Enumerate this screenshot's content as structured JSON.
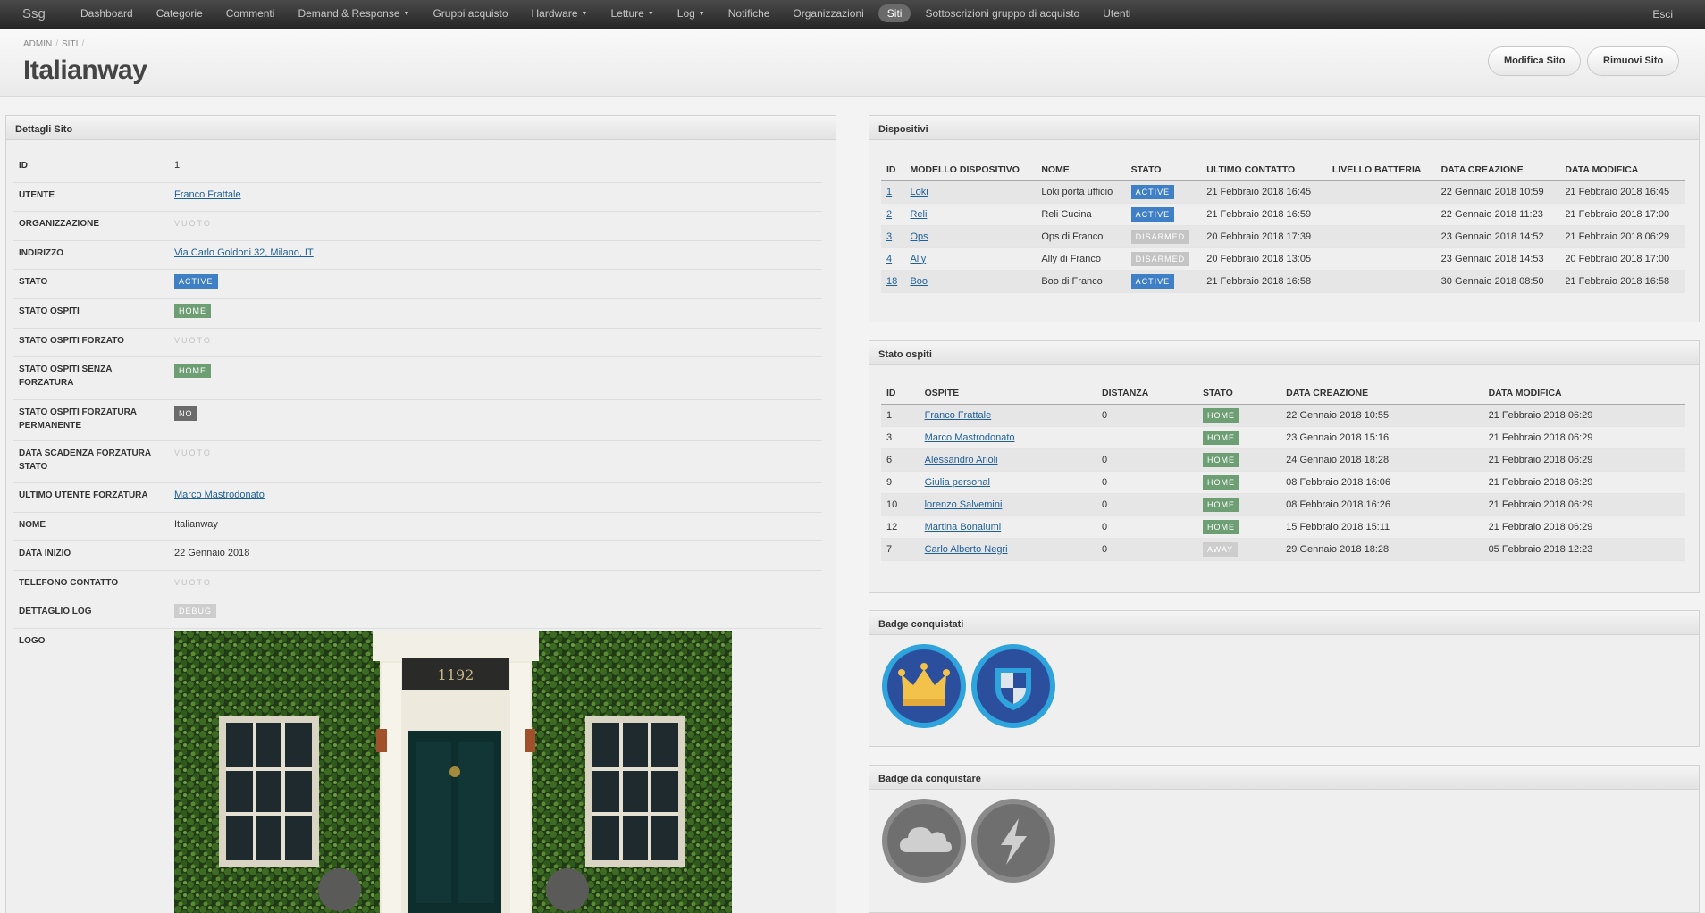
{
  "nav": {
    "brand": "Ssg",
    "items": [
      {
        "label": "Dashboard",
        "caret": false,
        "active": false
      },
      {
        "label": "Categorie",
        "caret": false,
        "active": false
      },
      {
        "label": "Commenti",
        "caret": false,
        "active": false
      },
      {
        "label": "Demand & Response",
        "caret": true,
        "active": false
      },
      {
        "label": "Gruppi acquisto",
        "caret": false,
        "active": false
      },
      {
        "label": "Hardware",
        "caret": true,
        "active": false
      },
      {
        "label": "Letture",
        "caret": true,
        "active": false
      },
      {
        "label": "Log",
        "caret": true,
        "active": false
      },
      {
        "label": "Notifiche",
        "caret": false,
        "active": false
      },
      {
        "label": "Organizzazioni",
        "caret": false,
        "active": false
      },
      {
        "label": "Siti",
        "caret": false,
        "active": true
      },
      {
        "label": "Sottoscrizioni gruppo di acquisto",
        "caret": false,
        "active": false
      },
      {
        "label": "Utenti",
        "caret": false,
        "active": false
      }
    ],
    "logout": "Esci"
  },
  "header": {
    "breadcrumb": [
      "ADMIN",
      "SITI"
    ],
    "breadcrumb_sep": "/",
    "title": "Italianway",
    "edit_button": "Modifica Sito",
    "remove_button": "Rimuovi Sito"
  },
  "details": {
    "title": "Dettagli Sito",
    "rows": [
      {
        "label": "ID",
        "value": "1",
        "type": "text"
      },
      {
        "label": "UTENTE",
        "value": "Franco Frattale",
        "type": "link"
      },
      {
        "label": "ORGANIZZAZIONE",
        "value": "VUOTO",
        "type": "empty"
      },
      {
        "label": "INDIRIZZO",
        "value": "Via Carlo Goldoni 32, Milano, IT",
        "type": "link"
      },
      {
        "label": "STATO",
        "value": "ACTIVE",
        "type": "badge",
        "color": "#3f7fc5"
      },
      {
        "label": "STATO OSPITI",
        "value": "HOME",
        "type": "badge",
        "color": "#6e9e74"
      },
      {
        "label": "STATO OSPITI FORZATO",
        "value": "VUOTO",
        "type": "empty"
      },
      {
        "label": "STATO OSPITI SENZA FORZATURA",
        "value": "HOME",
        "type": "badge",
        "color": "#6e9e74"
      },
      {
        "label": "STATO OSPITI FORZATURA PERMANENTE",
        "value": "NO",
        "type": "badge",
        "color": "#6b6b6b"
      },
      {
        "label": "DATA SCADENZA FORZATURA STATO",
        "value": "VUOTO",
        "type": "empty"
      },
      {
        "label": "ULTIMO UTENTE FORZATURA",
        "value": "Marco Mastrodonato",
        "type": "link"
      },
      {
        "label": "NOME",
        "value": "Italianway",
        "type": "text"
      },
      {
        "label": "DATA INIZIO",
        "value": "22 Gennaio 2018",
        "type": "text"
      },
      {
        "label": "TELEFONO CONTATTO",
        "value": "VUOTO",
        "type": "empty"
      },
      {
        "label": "DETTAGLIO LOG",
        "value": "DEBUG",
        "type": "badge",
        "color": "#cdcdcd"
      },
      {
        "label": "LOGO",
        "value": "",
        "type": "image"
      }
    ],
    "logo_number": "1192"
  },
  "devices": {
    "title": "Dispositivi",
    "columns": [
      "ID",
      "MODELLO DISPOSITIVO",
      "NOME",
      "STATO",
      "ULTIMO CONTATTO",
      "LIVELLO BATTERIA",
      "DATA CREAZIONE",
      "DATA MODIFICA"
    ],
    "rows": [
      {
        "id": "1",
        "model": "Loki",
        "name": "Loki porta ufficio",
        "status": "ACTIVE",
        "status_color": "#3f7fc5",
        "last_contact": "21 Febbraio 2018 16:45",
        "battery": "",
        "created": "22 Gennaio 2018 10:59",
        "modified": "21 Febbraio 2018 16:45"
      },
      {
        "id": "2",
        "model": "Reli",
        "name": "Reli Cucina",
        "status": "ACTIVE",
        "status_color": "#3f7fc5",
        "last_contact": "21 Febbraio 2018 16:59",
        "battery": "",
        "created": "22 Gennaio 2018 11:23",
        "modified": "21 Febbraio 2018 17:00"
      },
      {
        "id": "3",
        "model": "Ops",
        "name": "Ops di Franco",
        "status": "DISARMED",
        "status_color": "#c4c4c4",
        "last_contact": "20 Febbraio 2018 17:39",
        "battery": "",
        "created": "23 Gennaio 2018 14:52",
        "modified": "21 Febbraio 2018 06:29"
      },
      {
        "id": "4",
        "model": "Ally",
        "name": "Ally di Franco",
        "status": "DISARMED",
        "status_color": "#c4c4c4",
        "last_contact": "20 Febbraio 2018 13:05",
        "battery": "",
        "created": "23 Gennaio 2018 14:53",
        "modified": "20 Febbraio 2018 17:00"
      },
      {
        "id": "18",
        "model": "Boo",
        "name": "Boo di Franco",
        "status": "ACTIVE",
        "status_color": "#3f7fc5",
        "last_contact": "21 Febbraio 2018 16:58",
        "battery": "",
        "created": "30 Gennaio 2018 08:50",
        "modified": "21 Febbraio 2018 16:58"
      }
    ]
  },
  "guests": {
    "title": "Stato ospiti",
    "columns": [
      "ID",
      "OSPITE",
      "DISTANZA",
      "STATO",
      "DATA CREAZIONE",
      "DATA MODIFICA"
    ],
    "rows": [
      {
        "id": "1",
        "guest": "Franco Frattale",
        "distance": "0",
        "status": "HOME",
        "status_color": "#6e9e74",
        "created": "22 Gennaio 2018 10:55",
        "modified": "21 Febbraio 2018 06:29"
      },
      {
        "id": "3",
        "guest": "Marco Mastrodonato",
        "distance": "",
        "status": "HOME",
        "status_color": "#6e9e74",
        "created": "23 Gennaio 2018 15:16",
        "modified": "21 Febbraio 2018 06:29"
      },
      {
        "id": "6",
        "guest": "Alessandro Arioli",
        "distance": "0",
        "status": "HOME",
        "status_color": "#6e9e74",
        "created": "24 Gennaio 2018 18:28",
        "modified": "21 Febbraio 2018 06:29"
      },
      {
        "id": "9",
        "guest": "Giulia personal",
        "distance": "0",
        "status": "HOME",
        "status_color": "#6e9e74",
        "created": "08 Febbraio 2018 16:06",
        "modified": "21 Febbraio 2018 06:29"
      },
      {
        "id": "10",
        "guest": "lorenzo Salvemini",
        "distance": "0",
        "status": "HOME",
        "status_color": "#6e9e74",
        "created": "08 Febbraio 2018 16:26",
        "modified": "21 Febbraio 2018 06:29"
      },
      {
        "id": "12",
        "guest": "Martina Bonalumi",
        "distance": "0",
        "status": "HOME",
        "status_color": "#6e9e74",
        "created": "15 Febbraio 2018 15:11",
        "modified": "21 Febbraio 2018 06:29"
      },
      {
        "id": "7",
        "guest": "Carlo Alberto Negri",
        "distance": "0",
        "status": "AWAY",
        "status_color": "#cdcdcd",
        "created": "29 Gennaio 2018 18:28",
        "modified": "05 Febbraio 2018 12:23"
      }
    ]
  },
  "badges_earned": {
    "title": "Badge conquistati",
    "items": [
      {
        "icon": "crown-icon"
      },
      {
        "icon": "shield-icon"
      }
    ]
  },
  "badges_todo": {
    "title": "Badge da conquistare",
    "items": [
      {
        "icon": "cloud-icon"
      },
      {
        "icon": "lightning-icon"
      }
    ]
  },
  "colors": {
    "navbar": "#2f2f2f",
    "active_label": "#3f7fc5",
    "home_label": "#6e9e74",
    "link": "#1f5f9a",
    "badge_earned_ring": "#2fa3dc",
    "badge_earned_fill": "#2b4f9c",
    "badge_locked": "#7a7a7a"
  }
}
